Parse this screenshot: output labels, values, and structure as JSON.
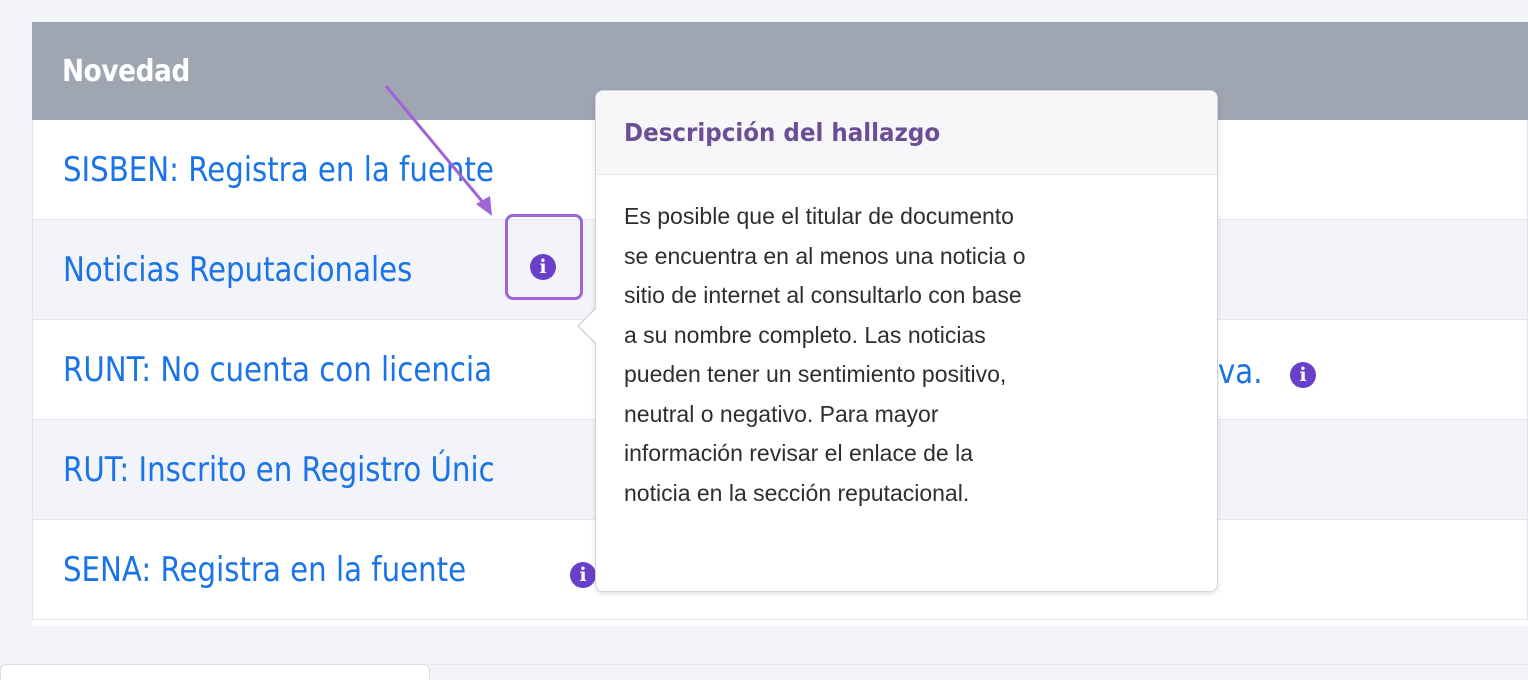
{
  "table": {
    "header": "Novedad",
    "rows": [
      {
        "text": "SISBEN: Registra en la fuente"
      },
      {
        "text": "Noticias Reputacionales"
      },
      {
        "text": "RUNT: No cuenta con licencia"
      },
      {
        "text": "RUT: Inscrito en Registro Únic"
      },
      {
        "text": "SENA: Registra en la fuente"
      }
    ],
    "runt_suffix": "va."
  },
  "popover": {
    "title": "Descripción del hallazgo",
    "lines": [
      "Es posible que el titular de documento",
      "se encuentra en al menos una noticia o",
      "sitio de internet al consultarlo con base",
      "a su nombre completo. Las noticias",
      "pueden tener un sentimiento positivo,",
      "neutral o negativo. Para mayor",
      "información revisar el enlace de la",
      "noticia en la sección reputacional."
    ]
  },
  "icons": {
    "info": "info-icon",
    "info_glyph": "i"
  },
  "colors": {
    "link": "#1a73e8",
    "header_bg": "#a0a5b2",
    "info_icon": "#6a3fc9",
    "annotation": "#9f64d8",
    "popover_title": "#6b4e96"
  }
}
